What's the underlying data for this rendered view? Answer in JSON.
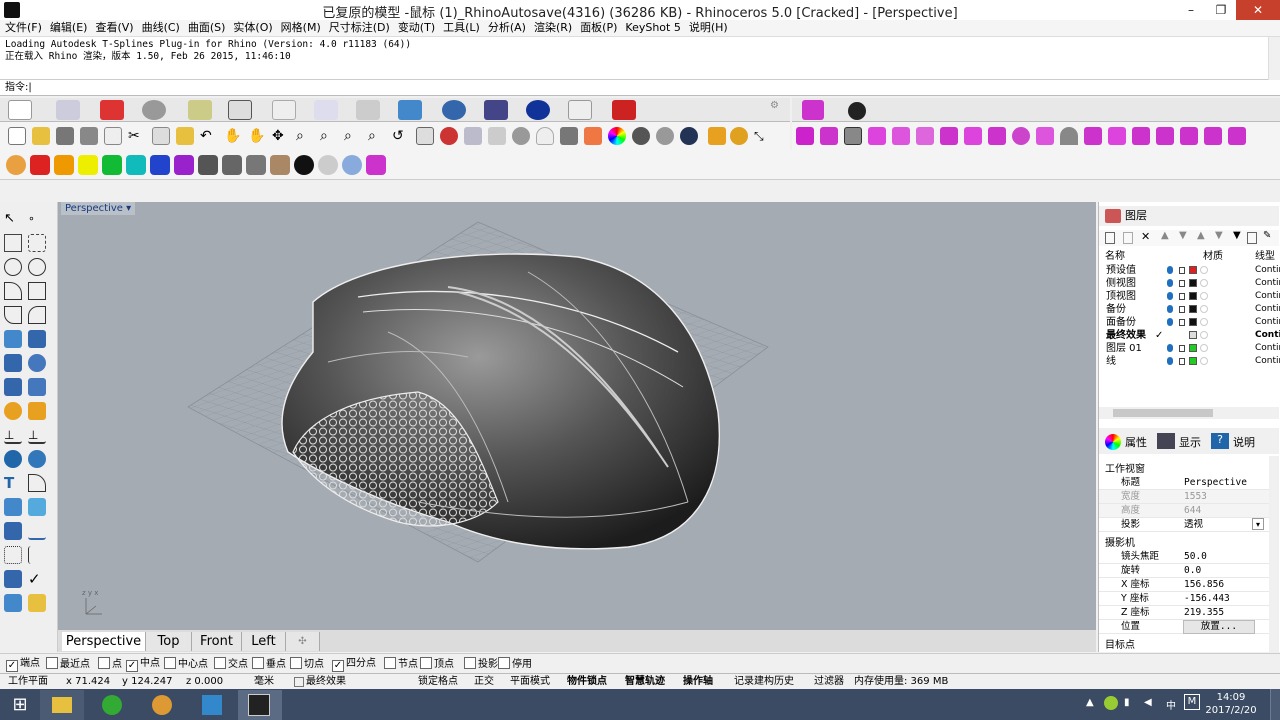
{
  "window": {
    "title": "已复原的模型 -鼠标 (1)_RhinoAutosave(4316) (36286 KB) - Rhinoceros 5.0 [Cracked] - [Perspective]",
    "minimize": "–",
    "maximize": "❐",
    "close": "✕"
  },
  "menu": [
    "文件(F)",
    "编辑(E)",
    "查看(V)",
    "曲线(C)",
    "曲面(S)",
    "实体(O)",
    "网格(M)",
    "尺寸标注(D)",
    "变动(T)",
    "工具(L)",
    "分析(A)",
    "渲染(R)",
    "面板(P)",
    "KeyShot 5",
    "说明(H)"
  ],
  "history": [
    "Loading Autodesk T-Splines Plug-in for Rhino (Version: 4.0 r11183 (64))",
    "正在载入 Rhino 渲染，版本 1.50, Feb 26 2015, 11:46:10"
  ],
  "command": {
    "prompt": "指令:"
  },
  "viewport": {
    "label": "Perspective",
    "axes": "z y x"
  },
  "viewtabs": [
    "Perspective",
    "Top",
    "Front",
    "Left",
    "✣"
  ],
  "layers": {
    "title": "图层",
    "columns": {
      "name": "名称",
      "material": "材质",
      "linetype": "线型"
    },
    "rows": [
      {
        "name": "预设值",
        "color": "#e02020",
        "linetype": "Contin"
      },
      {
        "name": "侧视图",
        "color": "#111111",
        "linetype": "Contin"
      },
      {
        "name": "顶视图",
        "color": "#111111",
        "linetype": "Contin"
      },
      {
        "name": "备份",
        "color": "#111111",
        "linetype": "Contin"
      },
      {
        "name": "面备份",
        "color": "#111111",
        "linetype": "Contin"
      },
      {
        "name": "最终效果",
        "color": "#dddddd",
        "linetype": "Contin",
        "current": "✓"
      },
      {
        "name": "图层 01",
        "color": "#22cc22",
        "linetype": "Contin"
      },
      {
        "name": "线",
        "color": "#22cc22",
        "linetype": "Contin"
      }
    ]
  },
  "props": {
    "tabs": [
      "属性",
      "显示",
      "说明"
    ],
    "section1": "工作视窗",
    "rows1": [
      {
        "k": "标题",
        "v": "Perspective"
      },
      {
        "k": "宽度",
        "v": "1553",
        "disabled": true
      },
      {
        "k": "高度",
        "v": "644",
        "disabled": true
      },
      {
        "k": "投影",
        "v": "透视"
      }
    ],
    "section2": "摄影机",
    "rows2": [
      {
        "k": "镜头焦距",
        "v": "50.0"
      },
      {
        "k": "旋转",
        "v": "0.0"
      },
      {
        "k": "X 座标",
        "v": "156.856"
      },
      {
        "k": "Y 座标",
        "v": "-156.443"
      },
      {
        "k": "Z 座标",
        "v": "219.355"
      },
      {
        "k": "位置",
        "v": "放置..."
      }
    ],
    "section3": "目标点"
  },
  "osnap": [
    {
      "label": "端点",
      "checked": true
    },
    {
      "label": "最近点",
      "checked": false
    },
    {
      "label": "点",
      "checked": false
    },
    {
      "label": "中点",
      "checked": true
    },
    {
      "label": "中心点",
      "checked": false
    },
    {
      "label": "交点",
      "checked": false
    },
    {
      "label": "垂点",
      "checked": false
    },
    {
      "label": "切点",
      "checked": false
    },
    {
      "label": "四分点",
      "checked": true
    },
    {
      "label": "节点",
      "checked": false
    },
    {
      "label": "顶点",
      "checked": false
    },
    {
      "label": "投影",
      "checked": false
    },
    {
      "label": "停用",
      "checked": false
    }
  ],
  "status": {
    "plane": "工作平面",
    "x": "x 71.424",
    "y": "y 124.247",
    "z": "z 0.000",
    "unit": "毫米",
    "layer": "最终效果",
    "grid": "锁定格点",
    "ortho": "正交",
    "planar": "平面模式",
    "osnap": "物件锁点",
    "smart": "智慧轨迹",
    "gumball": "操作轴",
    "history": "记录建构历史",
    "filter": "过滤器",
    "memory": "内存使用量: 369 MB"
  },
  "taskbar": {
    "time": "14:09",
    "date": "2017/2/20",
    "ime": "中",
    "tray_m": "M"
  }
}
